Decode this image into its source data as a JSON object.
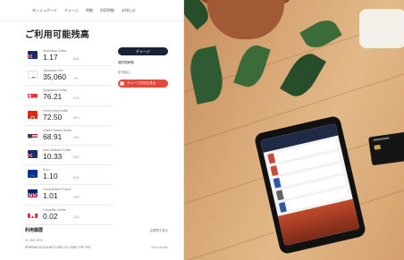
{
  "nav": {
    "items": [
      "ダッシュボード",
      "チャージ",
      "明細",
      "利用明細",
      "お知らせ"
    ]
  },
  "page": {
    "title": "ご利用可能残高"
  },
  "currencies": [
    {
      "name": "Australian Dollar",
      "amount": "1.17",
      "code": "AUD",
      "flag": "au"
    },
    {
      "name": "Japanese Yen",
      "amount": "35,060",
      "code": "JPY",
      "flag": "jp"
    },
    {
      "name": "Singapore Dollar",
      "amount": "76.21",
      "code": "SGD",
      "flag": "sg"
    },
    {
      "name": "Hong Kong Dollar",
      "amount": "72.50",
      "code": "HKD",
      "flag": "hk"
    },
    {
      "name": "United States Dollar",
      "amount": "68.91",
      "code": "USD",
      "flag": "us"
    },
    {
      "name": "New Zealand Dollar",
      "amount": "10.33",
      "code": "NZD",
      "flag": "nz"
    },
    {
      "name": "Euro",
      "amount": "1.10",
      "code": "EUR",
      "flag": "eu"
    },
    {
      "name": "Great British Pound",
      "amount": "1.01",
      "code": "GBP",
      "flag": "gb"
    },
    {
      "name": "Canadian Dollar",
      "amount": "0.02",
      "code": "CAD",
      "flag": "ca"
    }
  ],
  "actions": {
    "charge_label": "チャージ",
    "link1": "通貨間移動",
    "link2": "引き出し",
    "reload_label": "チャージ方法を見る"
  },
  "history": {
    "title": "利用履歴",
    "more": "全履歴を見る",
    "date": "01 JAN 2024",
    "row_text": "PREPAID ACCOUNT CARD TO CARD TRF FEE",
    "row_right": "Show details"
  },
  "colors": {
    "navy": "#1a2238",
    "accent_red": "#e24b3b"
  }
}
